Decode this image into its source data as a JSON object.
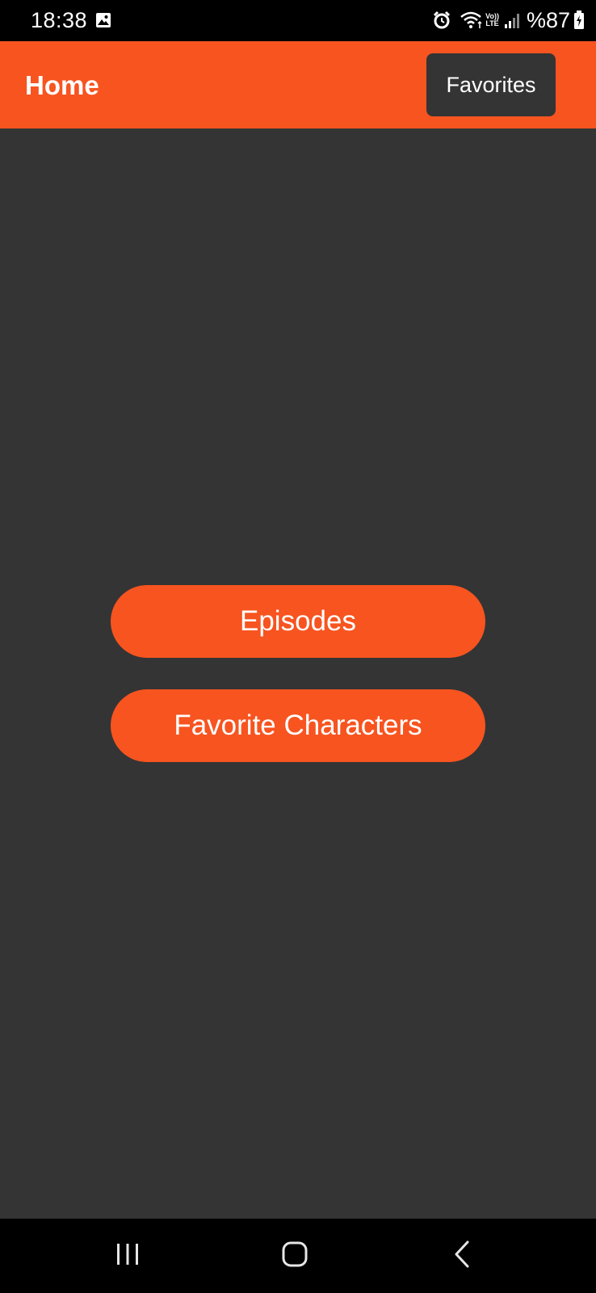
{
  "status_bar": {
    "time": "18:38",
    "battery": "%87",
    "network": "LTE",
    "volte": "Vo))",
    "icons": [
      "gallery-icon",
      "alarm-icon",
      "wifi-icon",
      "signal-icon",
      "battery-icon"
    ]
  },
  "app_bar": {
    "title": "Home",
    "favorites_label": "Favorites",
    "background_color": "#f75420"
  },
  "main": {
    "buttons": [
      {
        "label": "Episodes"
      },
      {
        "label": "Favorite Characters"
      }
    ],
    "background_color": "#343434",
    "accent_color": "#f75420"
  },
  "nav_bar": {
    "items": [
      "recents-icon",
      "home-icon",
      "back-icon"
    ]
  }
}
